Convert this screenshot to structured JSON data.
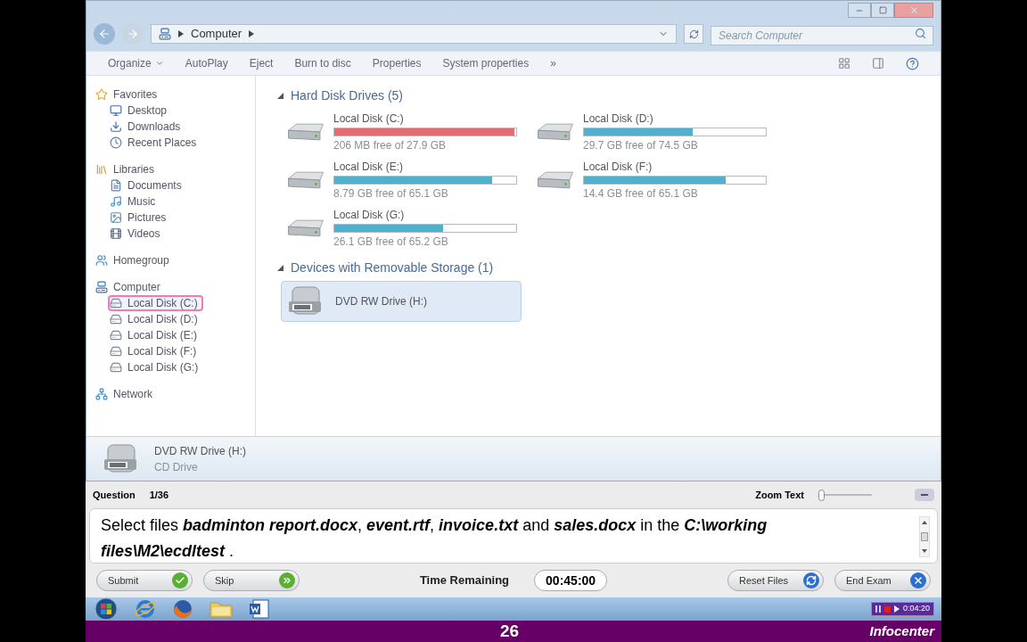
{
  "window": {
    "breadcrumb": [
      "Computer"
    ],
    "search": {
      "placeholder": "Search Computer"
    }
  },
  "toolbar": {
    "organize": "Organize",
    "items": [
      "AutoPlay",
      "Eject",
      "Burn to disc",
      "Properties",
      "System properties"
    ],
    "more": "»"
  },
  "nav": [
    {
      "kind": "star",
      "label": "Favorites",
      "selected": false,
      "children": [
        {
          "kind": "desktop",
          "label": "Desktop",
          "selected": false
        },
        {
          "kind": "download",
          "label": "Downloads",
          "selected": false
        },
        {
          "kind": "recent",
          "label": "Recent Places",
          "selected": false
        }
      ]
    },
    {
      "kind": "library",
      "label": "Libraries",
      "selected": false,
      "children": [
        {
          "kind": "document",
          "label": "Documents",
          "selected": false
        },
        {
          "kind": "music",
          "label": "Music",
          "selected": false
        },
        {
          "kind": "picture",
          "label": "Pictures",
          "selected": false
        },
        {
          "kind": "video",
          "label": "Videos",
          "selected": false
        }
      ]
    },
    {
      "kind": "homegroup",
      "label": "Homegroup",
      "selected": false
    },
    {
      "kind": "computer",
      "label": "Computer",
      "selected": false,
      "children": [
        {
          "kind": "disk",
          "label": "Local Disk (C:)",
          "selected": true
        },
        {
          "kind": "disk",
          "label": "Local Disk (D:)",
          "selected": false
        },
        {
          "kind": "disk",
          "label": "Local Disk (E:)",
          "selected": false
        },
        {
          "kind": "disk",
          "label": "Local Disk (F:)",
          "selected": false
        },
        {
          "kind": "disk",
          "label": "Local Disk (G:)",
          "selected": false
        }
      ]
    },
    {
      "kind": "network",
      "label": "Network",
      "selected": false
    }
  ],
  "groups": [
    {
      "title": "Hard Disk Drives (5)",
      "expanded": true,
      "drives": [
        {
          "kind": "disk",
          "name": "Local Disk (C:)",
          "free": "206 MB free of 27.9 GB",
          "level": 0.99,
          "color": "#e46b72",
          "selected": false
        },
        {
          "kind": "disk",
          "name": "Local Disk (D:)",
          "free": "29.7 GB free of 74.5 GB",
          "level": 0.6,
          "color": "#4fb0d0",
          "selected": false
        },
        {
          "kind": "disk",
          "name": "Local Disk (E:)",
          "free": "8.79 GB free of 65.1 GB",
          "level": 0.87,
          "color": "#4fb0d0",
          "selected": false
        },
        {
          "kind": "disk",
          "name": "Local Disk (F:)",
          "free": "14.4 GB free of 65.1 GB",
          "level": 0.78,
          "color": "#4fb0d0",
          "selected": false
        },
        {
          "kind": "disk",
          "name": "Local Disk (G:)",
          "free": "26.1 GB free of 65.2 GB",
          "level": 0.6,
          "color": "#4fb0d0",
          "selected": false
        }
      ]
    },
    {
      "title": "Devices with Removable Storage (1)",
      "expanded": true,
      "drives": [
        {
          "kind": "dvd",
          "name": "DVD RW Drive (H:)",
          "selected": true
        }
      ]
    }
  ],
  "details": {
    "name": "DVD RW Drive (H:)",
    "type": "CD Drive"
  },
  "exam": {
    "question_label": "Question",
    "question_number": "1/36",
    "zoom_label": "Zoom Text",
    "zoom": {
      "level": 0
    },
    "question": "Select files **badminton report.docx**, **event.rtf**, **invoice.txt** and **sales.docx** in the **C:\\working files\\M2\\ecdltest** .",
    "left_buttons": [
      {
        "kind": "submit",
        "label": "Submit"
      },
      {
        "kind": "skip",
        "label": "Skip"
      }
    ],
    "time_label": "Time Remaining",
    "time": "00:45:00",
    "right_buttons": [
      {
        "kind": "reset",
        "label": "Reset Files"
      },
      {
        "kind": "end",
        "label": "End Exam"
      }
    ]
  },
  "taskbar": {
    "apps": [
      {
        "kind": "start"
      },
      {
        "kind": "ie"
      },
      {
        "kind": "firefox"
      },
      {
        "kind": "explorer"
      },
      {
        "kind": "word"
      }
    ],
    "recorder_time": "0:04:20"
  },
  "footer": {
    "page": "26",
    "logo": "Infocenter"
  }
}
